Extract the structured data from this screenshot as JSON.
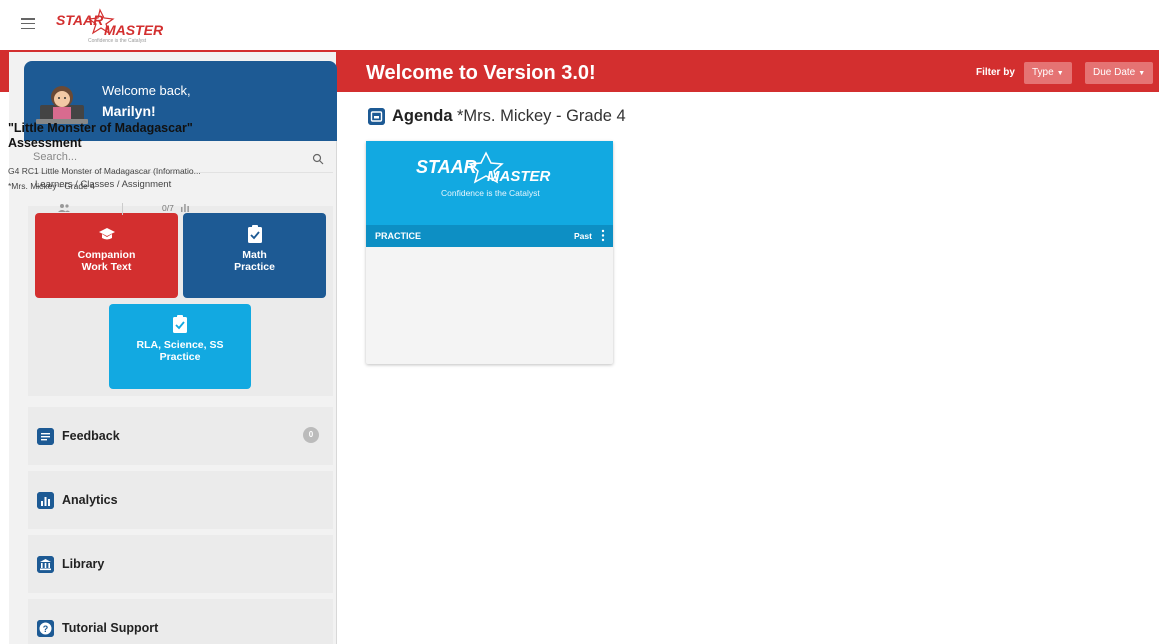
{
  "header": {
    "logo_text_top": "STAAR",
    "logo_text_bottom": "MASTER",
    "logo_tagline": "Confidence is the Catalyst",
    "menu_icon": "hamburger-icon"
  },
  "banner": {
    "title": "Welcome to Version 3.0!",
    "filter_label": "Filter by",
    "filters": [
      {
        "label": "Type",
        "icon": "caret-down-icon"
      },
      {
        "label": "Due Date",
        "icon": "caret-down-icon"
      }
    ]
  },
  "sidebar": {
    "welcome_line1": "Welcome back,",
    "welcome_name": "Marilyn!",
    "search_placeholder": "Search...",
    "breadcrumb": "Learners / Classes / Assignment",
    "tiles": [
      {
        "label_line1": "Companion",
        "label_line2": "Work Text",
        "icon": "graduation-cap-icon",
        "color": "#d32f2f"
      },
      {
        "label_line1": "Math",
        "label_line2": "Practice",
        "icon": "clipboard-check-icon",
        "color": "#1d5a94"
      },
      {
        "label_line1": "RLA, Science, SS",
        "label_line2": "Practice",
        "icon": "clipboard-check-icon",
        "color": "#12a9e1"
      }
    ],
    "items": [
      {
        "label": "Feedback",
        "icon": "message-icon",
        "badge": "0"
      },
      {
        "label": "Analytics",
        "icon": "bar-chart-icon"
      },
      {
        "label": "Library",
        "icon": "library-icon"
      },
      {
        "label": "Tutorial Support",
        "icon": "help-icon"
      }
    ]
  },
  "main": {
    "agenda_title": "Agenda",
    "agenda_subtitle": "*Mrs. Mickey - Grade 4",
    "cards": [
      {
        "logo_top": "STAAR",
        "logo_bottom": "MASTER",
        "logo_tagline": "Confidence is the Catalyst",
        "type": "PRACTICE",
        "status": "Past",
        "title": "\"Little Monster of Madagascar\" Assessment",
        "description": "G4 RC1 Little Monster of Madagascar (Informatio...",
        "class": "*Mrs. Mickey - Grade 4",
        "score": "0/7"
      }
    ]
  },
  "colors": {
    "brand_red": "#d32f2f",
    "brand_blue": "#1d5a94",
    "brand_light_blue": "#12a9e1"
  }
}
